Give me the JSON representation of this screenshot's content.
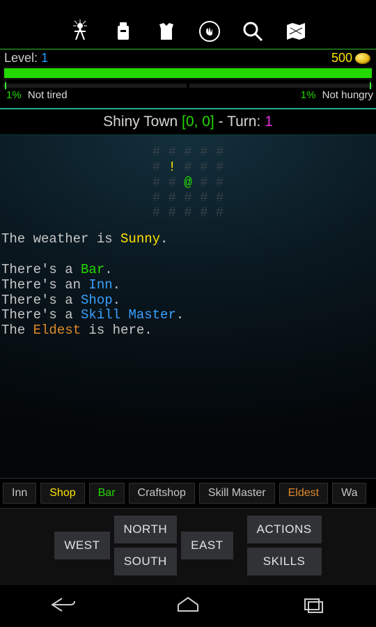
{
  "toolbar": {
    "icons": [
      "character-icon",
      "inventory-icon",
      "armor-icon",
      "hand-icon",
      "search-icon",
      "map-icon"
    ]
  },
  "level": {
    "label": "Level:",
    "value": "1"
  },
  "gold": {
    "value": "500"
  },
  "tired": {
    "pct": "1%",
    "text": "Not tired"
  },
  "hungry": {
    "pct": "1%",
    "text": "Not hungry"
  },
  "location": {
    "name": "Shiny Town",
    "coord_open": "[",
    "coord_x": "0",
    "coord_sep": ", ",
    "coord_y": "0",
    "coord_close": "]",
    "sep": " - ",
    "turn_label": "Turn: ",
    "turn_value": "1"
  },
  "map": {
    "row1": "# # # # #",
    "row2a": "# ",
    "row2b": "!",
    "row2c": " # # #",
    "row3a": "# # ",
    "row3b": "@",
    "row3c": " # #",
    "row4": "# # # # #",
    "row5": "# # # # #"
  },
  "desc": {
    "l1a": "The weather is ",
    "l1b": "Sunny",
    "l1c": ".",
    "l2a": "There's a ",
    "l2b": "Bar",
    "l2c": ".",
    "l3a": "There's an ",
    "l3b": "Inn",
    "l3c": ".",
    "l4a": "There's a ",
    "l4b": "Shop",
    "l4c": ".",
    "l5a": "There's a ",
    "l5b": "Skill Master",
    "l5c": ".",
    "l6a": "The ",
    "l6b": "Eldest",
    "l6c": " is here."
  },
  "places": {
    "inn": "Inn",
    "shop": "Shop",
    "bar": "Bar",
    "craftshop": "Craftshop",
    "skillmaster": "Skill Master",
    "eldest": "Eldest",
    "wander": "Wa"
  },
  "nav": {
    "north": "NORTH",
    "south": "SOUTH",
    "east": "EAST",
    "west": "WEST",
    "actions": "ACTIONS",
    "skills": "SKILLS"
  }
}
